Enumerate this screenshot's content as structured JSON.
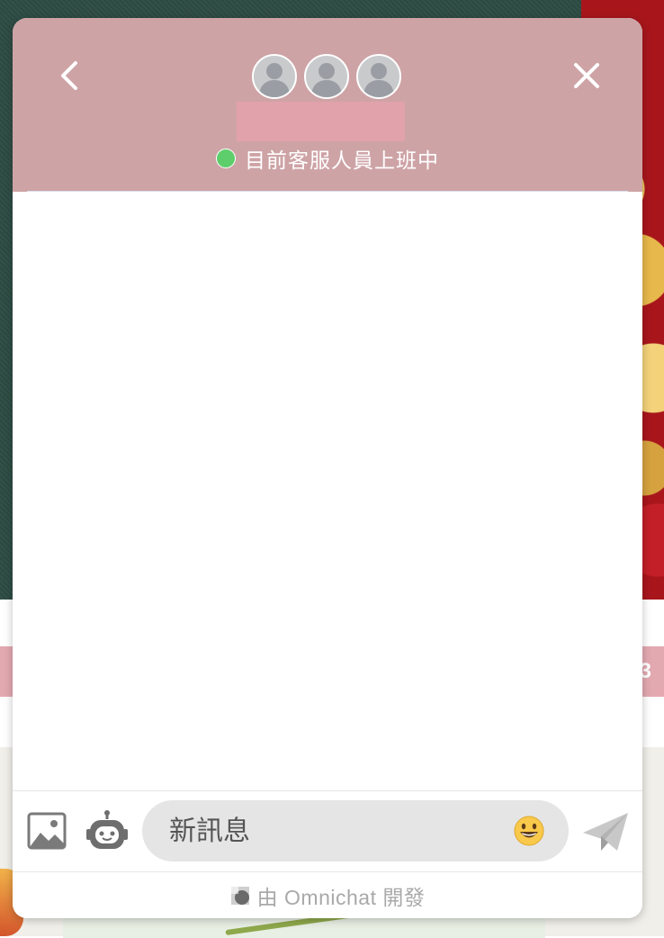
{
  "background": {
    "strip_text": "3"
  },
  "header": {
    "back_icon": "chevron-left-icon",
    "close_icon": "close-icon",
    "agent_avatars": [
      "default-user-avatar",
      "default-user-avatar",
      "default-user-avatar"
    ],
    "status_text": "目前客服人員上班中",
    "status_color": "#5dce6b",
    "header_color": "#cea3a6"
  },
  "composer": {
    "image_icon": "image-icon",
    "bot_icon": "robot-icon",
    "input_placeholder": "新訊息",
    "emoji_icon": "smiley-emoji-icon",
    "send_icon": "paper-plane-send-icon"
  },
  "footer": {
    "powered_by_text": "由 Omnichat 開發"
  }
}
